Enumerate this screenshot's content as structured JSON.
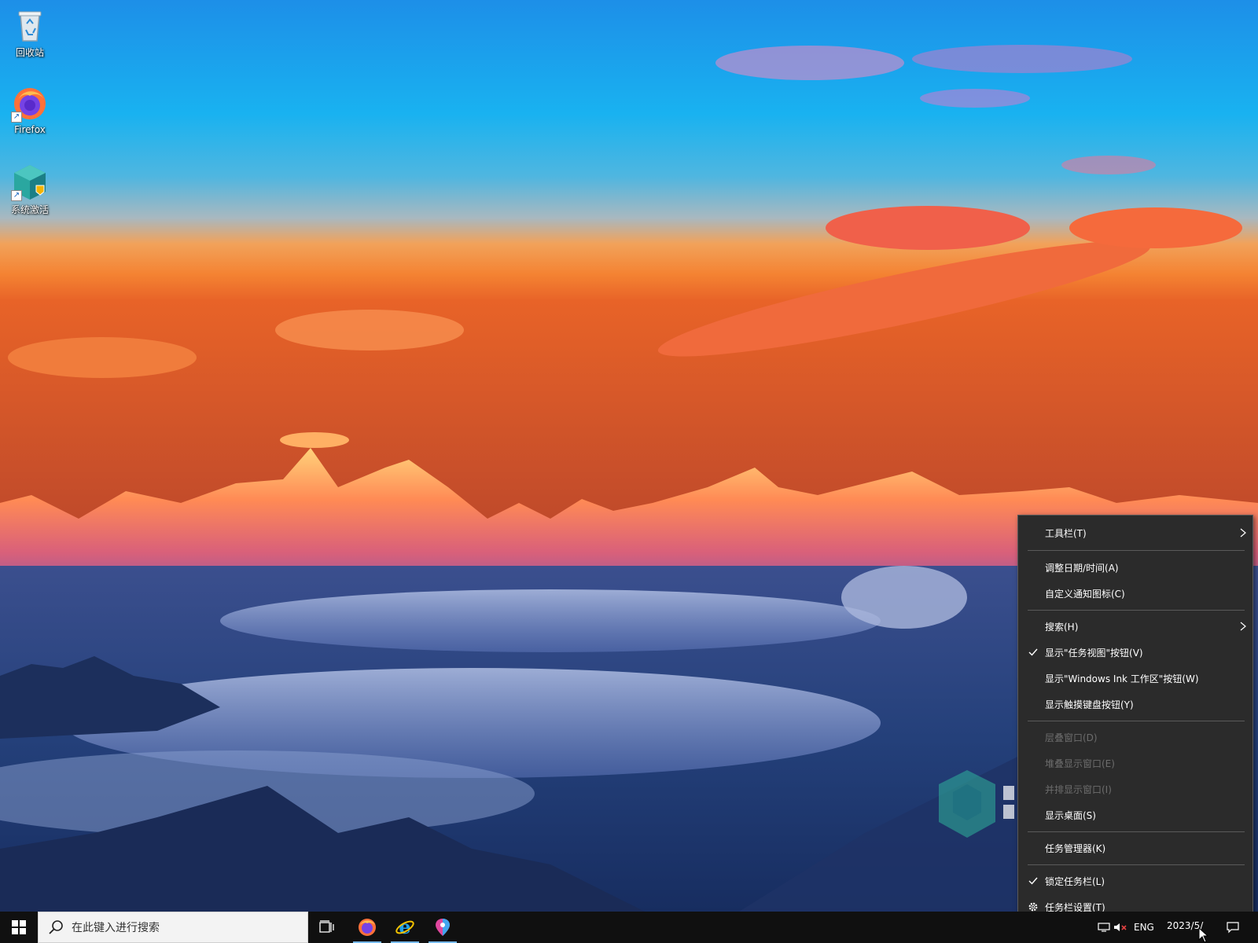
{
  "desktop": {
    "icons": [
      {
        "label": "回收站",
        "icon": "recycle-bin-icon"
      },
      {
        "label": "Firefox",
        "icon": "firefox-icon"
      },
      {
        "label": "系统激活",
        "icon": "system-activation-icon"
      }
    ]
  },
  "taskbar": {
    "search_placeholder": "在此键入进行搜索",
    "pinned_apps": [
      "firefox-icon",
      "internet-explorer-icon",
      "maps-icon"
    ],
    "tray": {
      "language": "ENG",
      "date": "2023/5/"
    }
  },
  "context_menu": {
    "items": [
      {
        "label": "工具栏(T)",
        "submenu": true,
        "checked": false,
        "disabled": false
      },
      {
        "label": "调整日期/时间(A)",
        "submenu": false,
        "checked": false,
        "disabled": false
      },
      {
        "label": "自定义通知图标(C)",
        "submenu": false,
        "checked": false,
        "disabled": false
      },
      {
        "label": "搜索(H)",
        "submenu": true,
        "checked": false,
        "disabled": false
      },
      {
        "label": "显示\"任务视图\"按钮(V)",
        "submenu": false,
        "checked": true,
        "disabled": false
      },
      {
        "label": "显示\"Windows Ink 工作区\"按钮(W)",
        "submenu": false,
        "checked": false,
        "disabled": false
      },
      {
        "label": "显示触摸键盘按钮(Y)",
        "submenu": false,
        "checked": false,
        "disabled": false
      },
      {
        "label": "层叠窗口(D)",
        "submenu": false,
        "checked": false,
        "disabled": true
      },
      {
        "label": "堆叠显示窗口(E)",
        "submenu": false,
        "checked": false,
        "disabled": true
      },
      {
        "label": "并排显示窗口(I)",
        "submenu": false,
        "checked": false,
        "disabled": true
      },
      {
        "label": "显示桌面(S)",
        "submenu": false,
        "checked": false,
        "disabled": false
      },
      {
        "label": "任务管理器(K)",
        "submenu": false,
        "checked": false,
        "disabled": false
      },
      {
        "label": "锁定任务栏(L)",
        "submenu": false,
        "checked": true,
        "disabled": false
      },
      {
        "label": "任务栏设置(T)",
        "submenu": false,
        "checked": false,
        "disabled": false,
        "icon": "gear-icon"
      }
    ]
  },
  "colors": {
    "menu_background": "#2b2b2b",
    "menu_text": "#ffffff",
    "menu_disabled_text": "#6d6d6d",
    "taskbar_background": "#101010"
  }
}
